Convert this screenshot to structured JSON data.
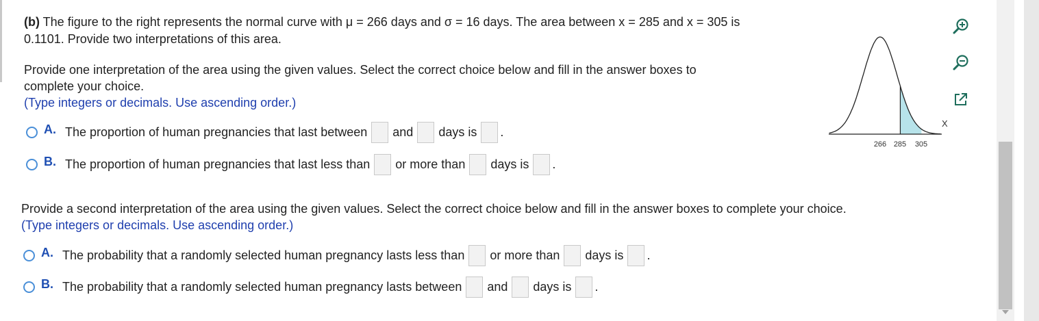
{
  "problem": {
    "part": "(b)",
    "text_line1": "The figure to the right represents the normal curve with μ = 266 days and σ = 16 days. The area between x = 285 and x = 305 is",
    "text_line2": "0.1101. Provide two interpretations of this area."
  },
  "section1": {
    "instruction_line1": "Provide one interpretation of the area using the given values. Select the correct choice below and fill in the answer boxes to",
    "instruction_line2": "complete your choice.",
    "hint": "(Type integers or decimals. Use ascending order.)",
    "choiceA": {
      "letter": "A.",
      "text1": "The proportion of human pregnancies that last between",
      "text2": "and",
      "text3": "days is",
      "end": "."
    },
    "choiceB": {
      "letter": "B.",
      "text1": "The proportion of human pregnancies that last less than",
      "text2": "or more than",
      "text3": "days is",
      "end": "."
    }
  },
  "section2": {
    "instruction": "Provide a second interpretation of the area using the given values. Select the correct choice below and fill in the answer boxes to complete your choice.",
    "hint": "(Type integers or decimals. Use ascending order.)",
    "choiceA": {
      "letter": "A.",
      "text1": "The probability that a randomly selected human pregnancy lasts less than",
      "text2": "or more than",
      "text3": "days is",
      "end": "."
    },
    "choiceB": {
      "letter": "B.",
      "text1": "The probability that a randomly selected human pregnancy lasts between",
      "text2": "and",
      "text3": "days is",
      "end": "."
    }
  },
  "figure": {
    "x_label": "X",
    "ticks": [
      "266",
      "285",
      "305"
    ],
    "shade_color": "#b7e3ea"
  },
  "tools": [
    "zoom-in-icon",
    "zoom-out-icon",
    "popout-icon"
  ]
}
